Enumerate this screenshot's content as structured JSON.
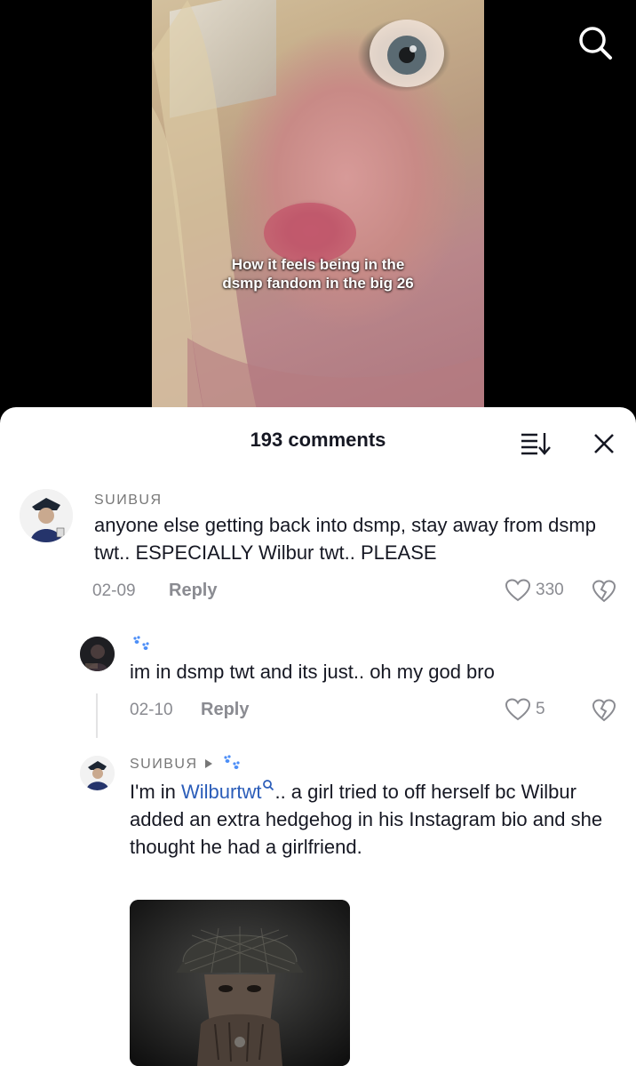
{
  "video": {
    "caption_line1": "How it feels being in the",
    "caption_line2": "dsmp fandom in the big 26"
  },
  "header": {
    "search_icon": "search-icon"
  },
  "comments_sheet": {
    "title": "193 comments",
    "sort_icon": "sort-icon",
    "close_icon": "close-icon"
  },
  "comments": [
    {
      "username": "SUИBUЯ",
      "text": "anyone else getting back into dsmp, stay away from dsmp twt.. ESPECIALLY Wilbur twt.. PLEASE",
      "date": "02-09",
      "reply_label": "Reply",
      "likes": "330"
    },
    {
      "username_icon": "paw-prints-icon",
      "text": "im in dsmp twt and its just.. oh my god bro",
      "date": "02-10",
      "reply_label": "Reply",
      "likes": "5"
    },
    {
      "username": "SUИBUЯ",
      "reply_to_icon": "paw-prints-icon",
      "text_before": "I'm in ",
      "hashtag": "Wilburtwt",
      "text_after": ".. a girl tried to off herself bc Wilbur added an extra hedgehog in his Instagram bio and she thought he had a girlfriend."
    }
  ],
  "colors": {
    "link": "#2b5db9",
    "text": "#161823",
    "muted": "#8a8b91"
  }
}
